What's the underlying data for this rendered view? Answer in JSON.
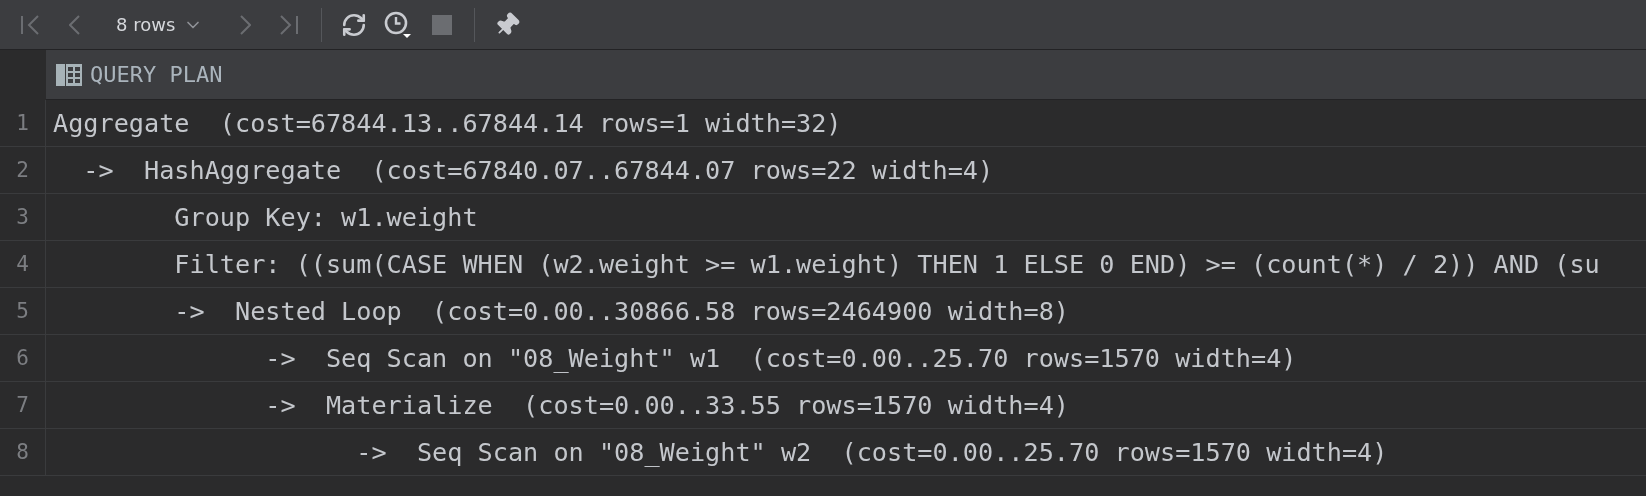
{
  "toolbar": {
    "nav_before": [
      {
        "kind": "first",
        "disabled": true
      },
      {
        "kind": "previous",
        "disabled": true
      }
    ],
    "page_size": {
      "label": "8 rows"
    },
    "nav_after": [
      {
        "kind": "next",
        "disabled": true
      },
      {
        "kind": "last",
        "disabled": true
      }
    ],
    "actions": [
      {
        "kind": "refresh",
        "disabled": false
      },
      {
        "kind": "history",
        "disabled": false
      },
      {
        "kind": "stop",
        "disabled": true
      },
      {
        "kind": "pin",
        "disabled": false
      }
    ]
  },
  "table": {
    "columns": [
      {
        "label": "QUERY PLAN"
      }
    ],
    "rows": [
      {
        "number": "1",
        "text": "Aggregate  (cost=67844.13..67844.14 rows=1 width=32)"
      },
      {
        "number": "2",
        "text": "  ->  HashAggregate  (cost=67840.07..67844.07 rows=22 width=4)"
      },
      {
        "number": "3",
        "text": "        Group Key: w1.weight"
      },
      {
        "number": "4",
        "text": "        Filter: ((sum(CASE WHEN (w2.weight >= w1.weight) THEN 1 ELSE 0 END) >= (count(*) / 2)) AND (su"
      },
      {
        "number": "5",
        "text": "        ->  Nested Loop  (cost=0.00..30866.58 rows=2464900 width=8)"
      },
      {
        "number": "6",
        "text": "              ->  Seq Scan on \"08_Weight\" w1  (cost=0.00..25.70 rows=1570 width=4)"
      },
      {
        "number": "7",
        "text": "              ->  Materialize  (cost=0.00..33.55 rows=1570 width=4)"
      },
      {
        "number": "8",
        "text": "                    ->  Seq Scan on \"08_Weight\" w2  (cost=0.00..25.70 rows=1570 width=4)"
      }
    ]
  }
}
